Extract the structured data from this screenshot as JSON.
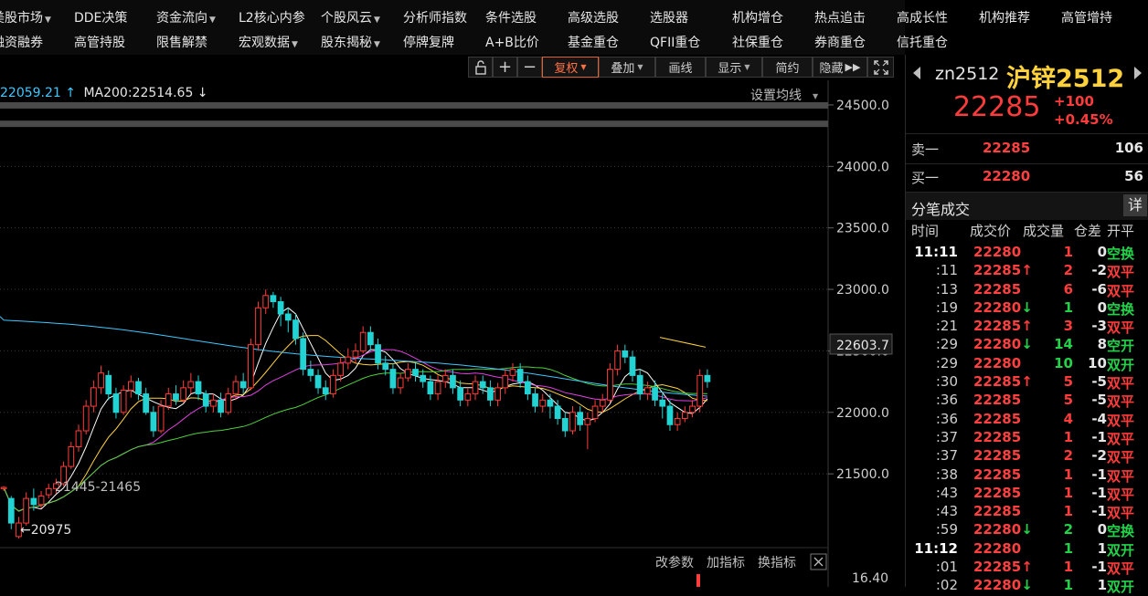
{
  "menu": {
    "row1": [
      {
        "label": "美股市场",
        "caret": true
      },
      {
        "label": "DDE决策",
        "caret": false
      },
      {
        "label": "资金流向",
        "caret": true
      },
      {
        "label": "L2核心内参",
        "caret": false
      },
      {
        "label": "个股风云",
        "caret": true
      },
      {
        "label": "分析师指数",
        "caret": false
      },
      {
        "label": "条件选股",
        "caret": false
      },
      {
        "label": "高级选股",
        "caret": false
      },
      {
        "label": "选股器",
        "caret": false
      },
      {
        "label": "机构增仓",
        "caret": false
      },
      {
        "label": "热点追击",
        "caret": false
      },
      {
        "label": "高成长性",
        "caret": false
      },
      {
        "label": "机构推荐",
        "caret": false
      },
      {
        "label": "高管增持",
        "caret": false
      }
    ],
    "row2": [
      {
        "label": "融资融券",
        "caret": false
      },
      {
        "label": "高管持股",
        "caret": false
      },
      {
        "label": "限售解禁",
        "caret": false
      },
      {
        "label": "宏观数据",
        "caret": true
      },
      {
        "label": "股东揭秘",
        "caret": true
      },
      {
        "label": "停牌复牌",
        "caret": false
      },
      {
        "label": "A+B比价",
        "caret": false
      },
      {
        "label": "基金重仓",
        "caret": false
      },
      {
        "label": "QFII重仓",
        "caret": false
      },
      {
        "label": "社保重仓",
        "caret": false
      },
      {
        "label": "券商重仓",
        "caret": false
      },
      {
        "label": "信托重仓",
        "caret": false
      }
    ]
  },
  "toolbar": {
    "lock_icon": "lock-icon",
    "plus": "+",
    "minus": "−",
    "fuquan": "复权",
    "diejia": "叠加",
    "huaxian": "画线",
    "xianshi": "显示",
    "jianyue": "简约",
    "yincang": "隐藏",
    "expand_icon": "expand-icon"
  },
  "ma_legend": {
    "ma_prev": "22059.21",
    "ma200_label": "MA200:22514.65"
  },
  "chart": {
    "settings": "设置均线",
    "axis_labels": [
      "24500.0",
      "24000.0",
      "23500.0",
      "23000.0",
      "22500.0",
      "22000.0",
      "21500.0"
    ],
    "current_price_label": "22603.7",
    "low_label": "←20975",
    "range_label": "21445-21465",
    "indicator_buttons": [
      "改参数",
      "加指标",
      "换指标"
    ],
    "close_icon": "close-icon",
    "sub_axis_label": "16.40"
  },
  "chart_data": {
    "type": "candlestick",
    "ylim": [
      20900,
      24700
    ],
    "resistance": [
      24500,
      24350
    ],
    "candles": [
      [
        21380,
        21390,
        21360,
        21400
      ],
      [
        21300,
        21100,
        21050,
        21320
      ],
      [
        20990,
        21100,
        20975,
        21150
      ],
      [
        21100,
        21300,
        21080,
        21350
      ],
      [
        21300,
        21250,
        21200,
        21380
      ],
      [
        21250,
        21320,
        21220,
        21360
      ],
      [
        21330,
        21380,
        21300,
        21420
      ],
      [
        21380,
        21420,
        21340,
        21460
      ],
      [
        21420,
        21560,
        21400,
        21600
      ],
      [
        21560,
        21720,
        21540,
        21760
      ],
      [
        21720,
        21850,
        21680,
        21900
      ],
      [
        21850,
        22050,
        21820,
        22100
      ],
      [
        22050,
        22200,
        22000,
        22260
      ],
      [
        22200,
        22320,
        22150,
        22380
      ],
      [
        22300,
        22150,
        22100,
        22340
      ],
      [
        22150,
        22000,
        21950,
        22200
      ],
      [
        22000,
        22180,
        21980,
        22220
      ],
      [
        22180,
        22250,
        22120,
        22300
      ],
      [
        22250,
        22150,
        22100,
        22280
      ],
      [
        22150,
        22000,
        21980,
        22200
      ],
      [
        22000,
        21850,
        21800,
        22050
      ],
      [
        21850,
        22050,
        21830,
        22100
      ],
      [
        22050,
        22150,
        22020,
        22200
      ],
      [
        22150,
        22100,
        22060,
        22220
      ],
      [
        22100,
        22200,
        22080,
        22260
      ],
      [
        22200,
        22250,
        22150,
        22320
      ],
      [
        22250,
        22150,
        22100,
        22300
      ],
      [
        22150,
        22050,
        22000,
        22180
      ],
      [
        22050,
        22100,
        22000,
        22150
      ],
      [
        22100,
        22000,
        21960,
        22160
      ],
      [
        22000,
        22150,
        21980,
        22200
      ],
      [
        22150,
        22250,
        22100,
        22300
      ],
      [
        22250,
        22200,
        22150,
        22320
      ],
      [
        22200,
        22550,
        22180,
        22600
      ],
      [
        22550,
        22850,
        22500,
        22900
      ],
      [
        22850,
        22950,
        22800,
        23000
      ],
      [
        22950,
        22900,
        22850,
        22980
      ],
      [
        22900,
        22800,
        22700,
        22940
      ],
      [
        22800,
        22750,
        22650,
        22850
      ],
      [
        22750,
        22600,
        22550,
        22800
      ],
      [
        22600,
        22350,
        22300,
        22650
      ],
      [
        22350,
        22300,
        22250,
        22420
      ],
      [
        22300,
        22200,
        22150,
        22350
      ],
      [
        22200,
        22150,
        22100,
        22260
      ],
      [
        22150,
        22300,
        22120,
        22350
      ],
      [
        22300,
        22400,
        22250,
        22450
      ],
      [
        22400,
        22450,
        22350,
        22520
      ],
      [
        22450,
        22500,
        22400,
        22560
      ],
      [
        22500,
        22650,
        22480,
        22700
      ],
      [
        22650,
        22550,
        22500,
        22700
      ],
      [
        22550,
        22400,
        22350,
        22600
      ],
      [
        22400,
        22350,
        22300,
        22460
      ],
      [
        22350,
        22200,
        22150,
        22400
      ],
      [
        22200,
        22280,
        22150,
        22320
      ],
      [
        22280,
        22350,
        22250,
        22400
      ],
      [
        22350,
        22300,
        22250,
        22400
      ],
      [
        22300,
        22250,
        22200,
        22350
      ],
      [
        22250,
        22150,
        22100,
        22300
      ],
      [
        22150,
        22250,
        22100,
        22300
      ],
      [
        22250,
        22300,
        22200,
        22350
      ],
      [
        22300,
        22200,
        22150,
        22350
      ],
      [
        22200,
        22100,
        22050,
        22260
      ],
      [
        22100,
        22150,
        22050,
        22200
      ],
      [
        22150,
        22250,
        22100,
        22300
      ],
      [
        22250,
        22200,
        22150,
        22300
      ],
      [
        22200,
        22100,
        22050,
        22260
      ],
      [
        22100,
        22200,
        22050,
        22240
      ],
      [
        22200,
        22300,
        22150,
        22350
      ],
      [
        22300,
        22350,
        22250,
        22400
      ],
      [
        22350,
        22250,
        22200,
        22400
      ],
      [
        22250,
        22150,
        22100,
        22300
      ],
      [
        22150,
        22050,
        22000,
        22200
      ],
      [
        22050,
        22100,
        22000,
        22150
      ],
      [
        22100,
        22050,
        21950,
        22150
      ],
      [
        22050,
        21950,
        21900,
        22100
      ],
      [
        21950,
        21850,
        21800,
        22000
      ],
      [
        21850,
        22000,
        21820,
        22050
      ],
      [
        22000,
        21900,
        21850,
        22050
      ],
      [
        21900,
        21950,
        21700,
        22000
      ],
      [
        21950,
        22050,
        21920,
        22100
      ],
      [
        22050,
        22100,
        22000,
        22150
      ],
      [
        22100,
        22350,
        22080,
        22400
      ],
      [
        22350,
        22500,
        22300,
        22550
      ],
      [
        22500,
        22450,
        22400,
        22550
      ],
      [
        22450,
        22300,
        22250,
        22500
      ],
      [
        22300,
        22150,
        22100,
        22350
      ],
      [
        22150,
        22200,
        22100,
        22250
      ],
      [
        22200,
        22100,
        22050,
        22260
      ],
      [
        22100,
        22050,
        21950,
        22150
      ],
      [
        22050,
        21900,
        21850,
        22100
      ],
      [
        21900,
        21950,
        21850,
        22000
      ],
      [
        21950,
        22000,
        21920,
        22050
      ],
      [
        22000,
        22050,
        21960,
        22100
      ],
      [
        22050,
        22300,
        22000,
        22350
      ],
      [
        22300,
        22250,
        22200,
        22350
      ]
    ]
  },
  "quote": {
    "code": "zn2512",
    "name": "沪锌2512",
    "price": "22285",
    "change": "+100",
    "change_pct": "+0.45%",
    "prev_icon": "chevron-left-icon",
    "next_icon": "chevron-right-icon"
  },
  "book": {
    "sell": {
      "label": "卖一",
      "price": "22285",
      "qty": "106"
    },
    "buy": {
      "label": "买一",
      "price": "22280",
      "qty": "56"
    }
  },
  "tape": {
    "title": "分笔成交",
    "detail": "详",
    "headers": [
      "时间",
      "成交价",
      "成交量",
      "仓差",
      "开平"
    ],
    "rows": [
      {
        "t": "11:11",
        "bold": true,
        "p": "22280",
        "arrow": "",
        "v": "1",
        "vd": "up",
        "d": "0",
        "n": "空换",
        "nd": "dn"
      },
      {
        "t": ":11",
        "bold": false,
        "p": "22285",
        "arrow": "↑",
        "v": "2",
        "vd": "up",
        "d": "-2",
        "n": "双平",
        "nd": "up"
      },
      {
        "t": ":13",
        "bold": false,
        "p": "22285",
        "arrow": "",
        "v": "6",
        "vd": "up",
        "d": "-6",
        "n": "双平",
        "nd": "up"
      },
      {
        "t": ":19",
        "bold": false,
        "p": "22280",
        "arrow": "↓",
        "v": "1",
        "vd": "dn",
        "d": "0",
        "n": "空换",
        "nd": "dn"
      },
      {
        "t": ":21",
        "bold": false,
        "p": "22285",
        "arrow": "↑",
        "v": "3",
        "vd": "up",
        "d": "-3",
        "n": "双平",
        "nd": "up"
      },
      {
        "t": ":29",
        "bold": false,
        "p": "22280",
        "arrow": "↓",
        "v": "14",
        "vd": "dn",
        "d": "8",
        "n": "空开",
        "nd": "dn"
      },
      {
        "t": ":29",
        "bold": false,
        "p": "22280",
        "arrow": "",
        "v": "10",
        "vd": "dn",
        "d": "10",
        "n": "双开",
        "nd": "dn"
      },
      {
        "t": ":30",
        "bold": false,
        "p": "22285",
        "arrow": "↑",
        "v": "5",
        "vd": "up",
        "d": "-5",
        "n": "双平",
        "nd": "up"
      },
      {
        "t": ":36",
        "bold": false,
        "p": "22285",
        "arrow": "",
        "v": "5",
        "vd": "up",
        "d": "-5",
        "n": "双平",
        "nd": "up"
      },
      {
        "t": ":36",
        "bold": false,
        "p": "22285",
        "arrow": "",
        "v": "4",
        "vd": "up",
        "d": "-4",
        "n": "双平",
        "nd": "up"
      },
      {
        "t": ":37",
        "bold": false,
        "p": "22285",
        "arrow": "",
        "v": "1",
        "vd": "up",
        "d": "-1",
        "n": "双平",
        "nd": "up"
      },
      {
        "t": ":37",
        "bold": false,
        "p": "22285",
        "arrow": "",
        "v": "2",
        "vd": "up",
        "d": "-2",
        "n": "双平",
        "nd": "up"
      },
      {
        "t": ":38",
        "bold": false,
        "p": "22285",
        "arrow": "",
        "v": "1",
        "vd": "up",
        "d": "-1",
        "n": "双平",
        "nd": "up"
      },
      {
        "t": ":43",
        "bold": false,
        "p": "22285",
        "arrow": "",
        "v": "1",
        "vd": "up",
        "d": "-1",
        "n": "双平",
        "nd": "up"
      },
      {
        "t": ":43",
        "bold": false,
        "p": "22285",
        "arrow": "",
        "v": "1",
        "vd": "up",
        "d": "-1",
        "n": "双平",
        "nd": "up"
      },
      {
        "t": ":59",
        "bold": false,
        "p": "22280",
        "arrow": "↓",
        "v": "2",
        "vd": "dn",
        "d": "0",
        "n": "空换",
        "nd": "dn"
      },
      {
        "t": "11:12",
        "bold": true,
        "p": "22280",
        "arrow": "",
        "v": "1",
        "vd": "dn",
        "d": "1",
        "n": "双开",
        "nd": "dn"
      },
      {
        "t": ":01",
        "bold": false,
        "p": "22285",
        "arrow": "↑",
        "v": "1",
        "vd": "up",
        "d": "-1",
        "n": "双平",
        "nd": "up"
      },
      {
        "t": ":02",
        "bold": false,
        "p": "22280",
        "arrow": "↓",
        "v": "1",
        "vd": "dn",
        "d": "1",
        "n": "双开",
        "nd": "dn"
      }
    ]
  },
  "colors": {
    "up": "#ff3b3b",
    "down": "#22d3d3",
    "green": "#22d34a",
    "accent": "#e0622e",
    "yellow": "#ffd23c"
  }
}
